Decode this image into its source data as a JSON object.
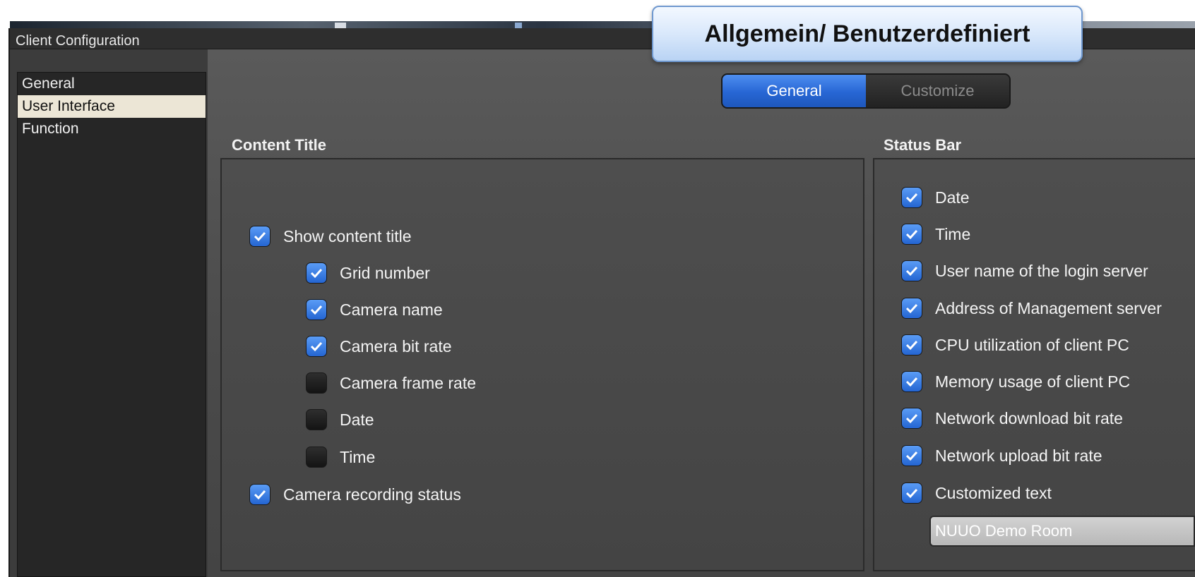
{
  "window": {
    "title": "Client Configuration"
  },
  "callout": {
    "text": "Allgemein/  Benutzerdefiniert"
  },
  "sidebar": {
    "items": [
      {
        "label": "General",
        "selected": false
      },
      {
        "label": "User Interface",
        "selected": true
      },
      {
        "label": "Function",
        "selected": false
      }
    ]
  },
  "tabs": [
    {
      "label": "General",
      "active": true
    },
    {
      "label": "Customize",
      "active": false
    }
  ],
  "content_title": {
    "heading": "Content Title",
    "options": [
      {
        "label": "Show content title",
        "checked": true
      },
      {
        "label": "Grid number",
        "checked": true
      },
      {
        "label": "Camera name",
        "checked": true
      },
      {
        "label": "Camera bit rate",
        "checked": true
      },
      {
        "label": "Camera frame rate",
        "checked": false
      },
      {
        "label": "Date",
        "checked": false
      },
      {
        "label": "Time",
        "checked": false
      },
      {
        "label": "Camera recording status",
        "checked": true
      }
    ]
  },
  "status_bar": {
    "heading": "Status Bar",
    "options": [
      {
        "label": "Date",
        "checked": true
      },
      {
        "label": "Time",
        "checked": true
      },
      {
        "label": "User name of the login server",
        "checked": true
      },
      {
        "label": "Address of Management server",
        "checked": true
      },
      {
        "label": "CPU utilization of client PC",
        "checked": true
      },
      {
        "label": "Memory usage of client PC",
        "checked": true
      },
      {
        "label": "Network download bit rate",
        "checked": true
      },
      {
        "label": "Network upload bit rate",
        "checked": true
      },
      {
        "label": "Customized text",
        "checked": true
      }
    ],
    "custom_text_value": "NUUO Demo Room"
  },
  "colors": {
    "accent": "#2a6fdc",
    "callout_border": "#6f98cf",
    "selected_item_bg": "#ece6d6"
  }
}
